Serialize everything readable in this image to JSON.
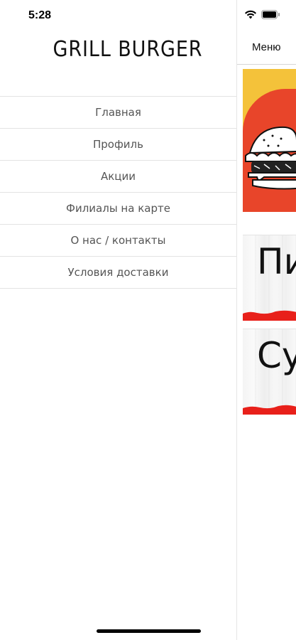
{
  "status_bar": {
    "time": "5:28",
    "icons": [
      "wifi-icon",
      "battery-icon"
    ]
  },
  "drawer": {
    "logo": "GRILL BURGER",
    "items": [
      {
        "label": "Главная"
      },
      {
        "label": "Профиль"
      },
      {
        "label": "Акции"
      },
      {
        "label": "Филиалы на карте"
      },
      {
        "label": "О нас / контакты"
      },
      {
        "label": "Условия доставки"
      }
    ]
  },
  "background": {
    "nav_title": "Меню",
    "categories": [
      {
        "label": "Пи"
      },
      {
        "label": "Су"
      }
    ]
  },
  "colors": {
    "accent_red": "#e8452a",
    "accent_yellow": "#f4c23a",
    "text_menu": "#555555"
  }
}
